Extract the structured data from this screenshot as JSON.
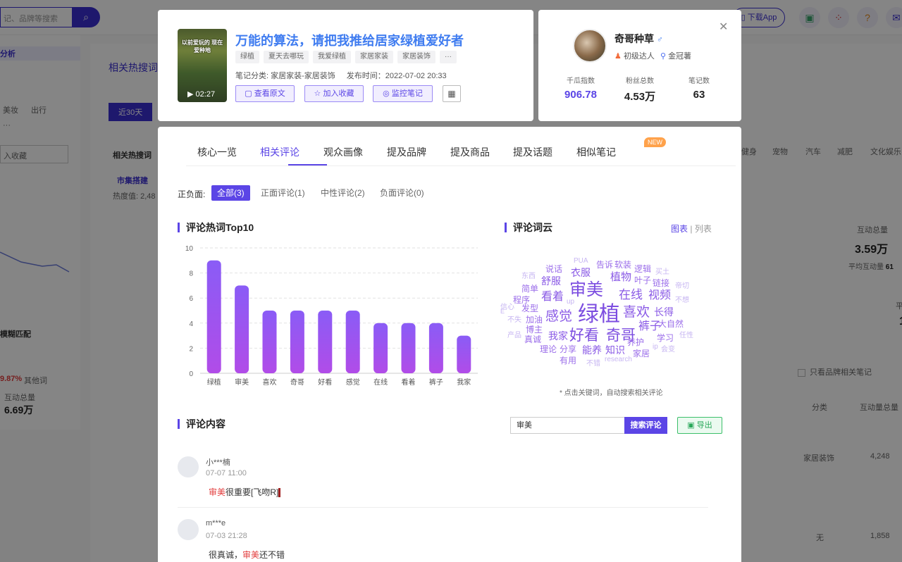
{
  "background": {
    "search_placeholder": "记、品牌等搜索",
    "download_app": "下载App",
    "left_items": [
      "分析",
      "美妆",
      "出行",
      "···",
      "入收藏",
      "模糊匹配",
      "9.87%",
      "其他词",
      "互动总量",
      "6.69万"
    ],
    "main_items": [
      "相关热搜词",
      "近30天",
      "相关热搜词",
      "市集搭建",
      "热度值: 2,48"
    ],
    "right_categories": [
      "健身",
      "宠物",
      "汽车",
      "减肥",
      "文化娱乐"
    ],
    "right_stats": {
      "label": "互动总量",
      "value": "3.59万",
      "avg_label": "平均互动量",
      "avg_value": "61",
      "partial": "平均",
      "partial2": "1"
    },
    "brand_filter": "只看品牌相关笔记",
    "table_headers": [
      "分类",
      "互动量总量"
    ],
    "table_rows": [
      {
        "cat": "家居装饰",
        "val": "4,248"
      },
      {
        "cat": "无",
        "val": "1,858"
      }
    ]
  },
  "note": {
    "thumb_caption": "以前爱玩的 现在爱种地",
    "duration": "02:27",
    "title": "万能的算法，请把我推给居家绿植爱好者",
    "tags": [
      "绿植",
      "夏天去哪玩",
      "我爱绿植",
      "家居家装",
      "家居装饰",
      "···"
    ],
    "category": "笔记分类: 家居家装-家居装饰",
    "publish_time": "发布时间：2022-07-02 20:33",
    "buttons": {
      "view_original": "查看原文",
      "add_favorite": "加入收藏",
      "monitor": "监控笔记"
    }
  },
  "author": {
    "name": "奇哥种草",
    "gender": "♂",
    "level": "初级达人",
    "rank": "金冠薯",
    "stats": [
      {
        "label": "千瓜指数",
        "value": "906.78",
        "color": "#5b45e6"
      },
      {
        "label": "粉丝总数",
        "value": "4.53万",
        "color": "#222"
      },
      {
        "label": "笔记数",
        "value": "63",
        "color": "#222"
      }
    ]
  },
  "tabs": [
    "核心一览",
    "相关评论",
    "观众画像",
    "提及品牌",
    "提及商品",
    "提及话题",
    "相似笔记"
  ],
  "new_badge": "NEW",
  "sentiment": {
    "label": "正负面:",
    "filters": [
      "全部(3)",
      "正面评论(1)",
      "中性评论(2)",
      "负面评论(0)"
    ]
  },
  "hotwords_title": "评论热词Top10",
  "chart_data": {
    "type": "bar",
    "title": "评论热词Top10",
    "categories": [
      "绿植",
      "审美",
      "喜欢",
      "奇哥",
      "好看",
      "感觉",
      "在线",
      "看着",
      "裤子",
      "我家"
    ],
    "values": [
      9,
      7,
      5,
      5,
      5,
      5,
      4,
      4,
      4,
      3
    ],
    "yticks": [
      "10",
      "8",
      "6",
      "4",
      "2",
      "0"
    ],
    "ylim": [
      0,
      10
    ],
    "grid": true,
    "colors": {
      "top": "#8a5cf6",
      "bottom": "#b14ce8"
    }
  },
  "cloud": {
    "title": "评论词云",
    "view_chart": "图表",
    "view_list": "列表",
    "separator": "|",
    "note": "* 点击关键词，自动搜索相关评论",
    "words": [
      {
        "t": "绿植",
        "s": 30,
        "c": "#7c4de0"
      },
      {
        "t": "审美",
        "s": 24,
        "c": "#7c4de0"
      },
      {
        "t": "好看",
        "s": 21,
        "c": "#7c4de0"
      },
      {
        "t": "奇哥",
        "s": 21,
        "c": "#7c4de0"
      },
      {
        "t": "感觉",
        "s": 19,
        "c": "#8a5ae6"
      },
      {
        "t": "喜欢",
        "s": 19,
        "c": "#8a5ae6"
      },
      {
        "t": "在线",
        "s": 17,
        "c": "#8a5ae6"
      },
      {
        "t": "视频",
        "s": 16,
        "c": "#8a5ae6"
      },
      {
        "t": "看着",
        "s": 16,
        "c": "#8a5ae6"
      },
      {
        "t": "裤子",
        "s": 16,
        "c": "#8a5ae6"
      },
      {
        "t": "植物",
        "s": 15,
        "c": "#8a5ae6"
      },
      {
        "t": "衣服",
        "s": 14,
        "c": "#8a5ae6"
      },
      {
        "t": "舒服",
        "s": 14,
        "c": "#8a5ae6"
      },
      {
        "t": "我家",
        "s": 14,
        "c": "#8a5ae6"
      },
      {
        "t": "长得",
        "s": 14,
        "c": "#8a5ae6"
      },
      {
        "t": "知识",
        "s": 14,
        "c": "#8a5ae6"
      },
      {
        "t": "能养",
        "s": 14,
        "c": "#8a5ae6"
      },
      {
        "t": "大自然",
        "s": 12,
        "c": "#9b6eea"
      },
      {
        "t": "发型",
        "s": 12,
        "c": "#9b6eea"
      },
      {
        "t": "加油",
        "s": 12,
        "c": "#9b6eea"
      },
      {
        "t": "博主",
        "s": 12,
        "c": "#9b6eea"
      },
      {
        "t": "真诚",
        "s": 12,
        "c": "#9b6eea"
      },
      {
        "t": "理论",
        "s": 12,
        "c": "#9b6eea"
      },
      {
        "t": "分享",
        "s": 12,
        "c": "#9b6eea"
      },
      {
        "t": "学习",
        "s": 12,
        "c": "#9b6eea"
      },
      {
        "t": "养护",
        "s": 12,
        "c": "#9b6eea"
      },
      {
        "t": "家居",
        "s": 12,
        "c": "#9b6eea"
      },
      {
        "t": "逻辑",
        "s": 12,
        "c": "#9b6eea"
      },
      {
        "t": "叶子",
        "s": 12,
        "c": "#9b6eea"
      },
      {
        "t": "链接",
        "s": 12,
        "c": "#9b6eea"
      },
      {
        "t": "告诉",
        "s": 12,
        "c": "#9b6eea"
      },
      {
        "t": "软装",
        "s": 12,
        "c": "#9b6eea"
      },
      {
        "t": "说话",
        "s": 12,
        "c": "#9b6eea"
      },
      {
        "t": "简单",
        "s": 12,
        "c": "#9b6eea"
      },
      {
        "t": "程序",
        "s": 12,
        "c": "#9b6eea"
      },
      {
        "t": "有用",
        "s": 12,
        "c": "#9b6eea"
      },
      {
        "t": "PUA",
        "s": 10,
        "c": "#c7b6f2"
      },
      {
        "t": "东西",
        "s": 10,
        "c": "#c7b6f2"
      },
      {
        "t": "up",
        "s": 10,
        "c": "#c7b6f2"
      },
      {
        "t": "信心",
        "s": 10,
        "c": "#c7b6f2"
      },
      {
        "t": "不失",
        "s": 10,
        "c": "#c7b6f2"
      },
      {
        "t": "产品",
        "s": 10,
        "c": "#c7b6f2"
      },
      {
        "t": "不错",
        "s": 10,
        "c": "#c7b6f2"
      },
      {
        "t": "research",
        "s": 10,
        "c": "#c7b6f2"
      },
      {
        "t": "ip",
        "s": 10,
        "c": "#c7b6f2"
      },
      {
        "t": "会变",
        "s": 10,
        "c": "#c7b6f2"
      },
      {
        "t": "任性",
        "s": 10,
        "c": "#c7b6f2"
      },
      {
        "t": "不想",
        "s": 10,
        "c": "#c7b6f2"
      },
      {
        "t": "帝切",
        "s": 10,
        "c": "#c7b6f2"
      },
      {
        "t": "买土",
        "s": 10,
        "c": "#c7b6f2"
      },
      {
        "t": "E",
        "s": 9,
        "c": "#c7b6f2"
      }
    ]
  },
  "comments_title": "评论内容",
  "comment_search": {
    "value": "审美",
    "button": "搜索评论",
    "export": "导出"
  },
  "comments": [
    {
      "user": "小***楠",
      "time": "07-07 11:00",
      "highlight": "审美",
      "rest": "很重要[飞吻R]"
    },
    {
      "user": "m***e",
      "time": "07-03 21:28",
      "prefix": "很真诚，",
      "highlight": "审美",
      "rest": "还不错"
    }
  ]
}
